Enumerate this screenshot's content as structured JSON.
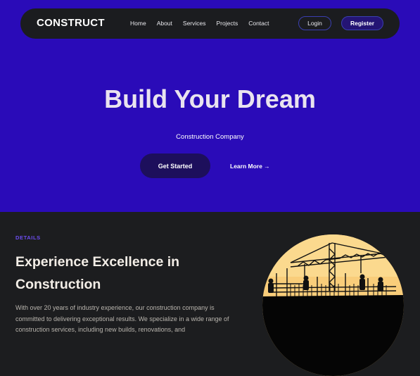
{
  "nav": {
    "logo": "CONSTRUCT",
    "links": [
      "Home",
      "About",
      "Services",
      "Projects",
      "Contact"
    ],
    "login_label": "Login",
    "register_label": "Register"
  },
  "hero": {
    "title": "Build Your Dream",
    "subtitle": "Construction Company",
    "cta_primary": "Get Started",
    "cta_secondary": "Learn More →"
  },
  "details": {
    "eyebrow": "DETAILS",
    "title": "Experience Excellence in Construction",
    "body": "With over 20 years of industry experience, our construction company is committed to delivering exceptional results. We specialize in a wide range of construction services, including new builds, renovations, and"
  },
  "colors": {
    "hero_bg": "#2a0bb8",
    "navbar_bg": "#1b1c1f",
    "section_bg": "#1c1d1f",
    "accent": "#6d4df2",
    "cta_bg": "#1d0f5c",
    "sky": "#f9cd7a"
  },
  "images": {
    "construction_photo": "construction-site-silhouette"
  }
}
